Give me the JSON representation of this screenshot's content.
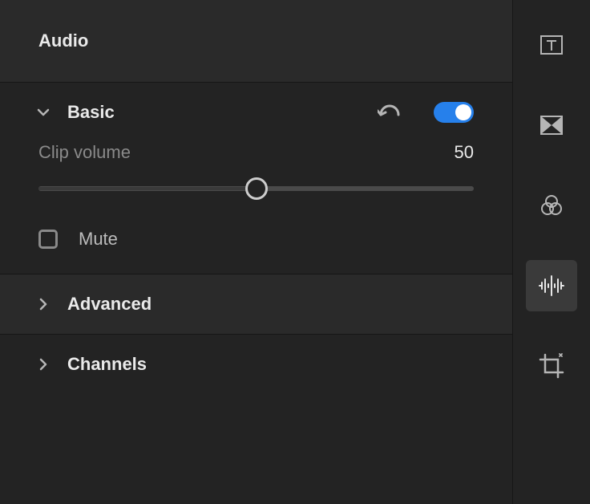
{
  "panel": {
    "title": "Audio"
  },
  "sections": {
    "basic": {
      "title": "Basic",
      "expanded": true,
      "enabled": true,
      "slider": {
        "label": "Clip volume",
        "value": "50"
      },
      "mute": {
        "label": "Mute",
        "checked": false
      }
    },
    "advanced": {
      "title": "Advanced",
      "expanded": false
    },
    "channels": {
      "title": "Channels",
      "expanded": false
    }
  },
  "rail": {
    "items": [
      {
        "name": "titles-icon"
      },
      {
        "name": "transitions-icon"
      },
      {
        "name": "color-icon"
      },
      {
        "name": "audio-icon",
        "active": true
      },
      {
        "name": "crop-icon"
      }
    ]
  }
}
